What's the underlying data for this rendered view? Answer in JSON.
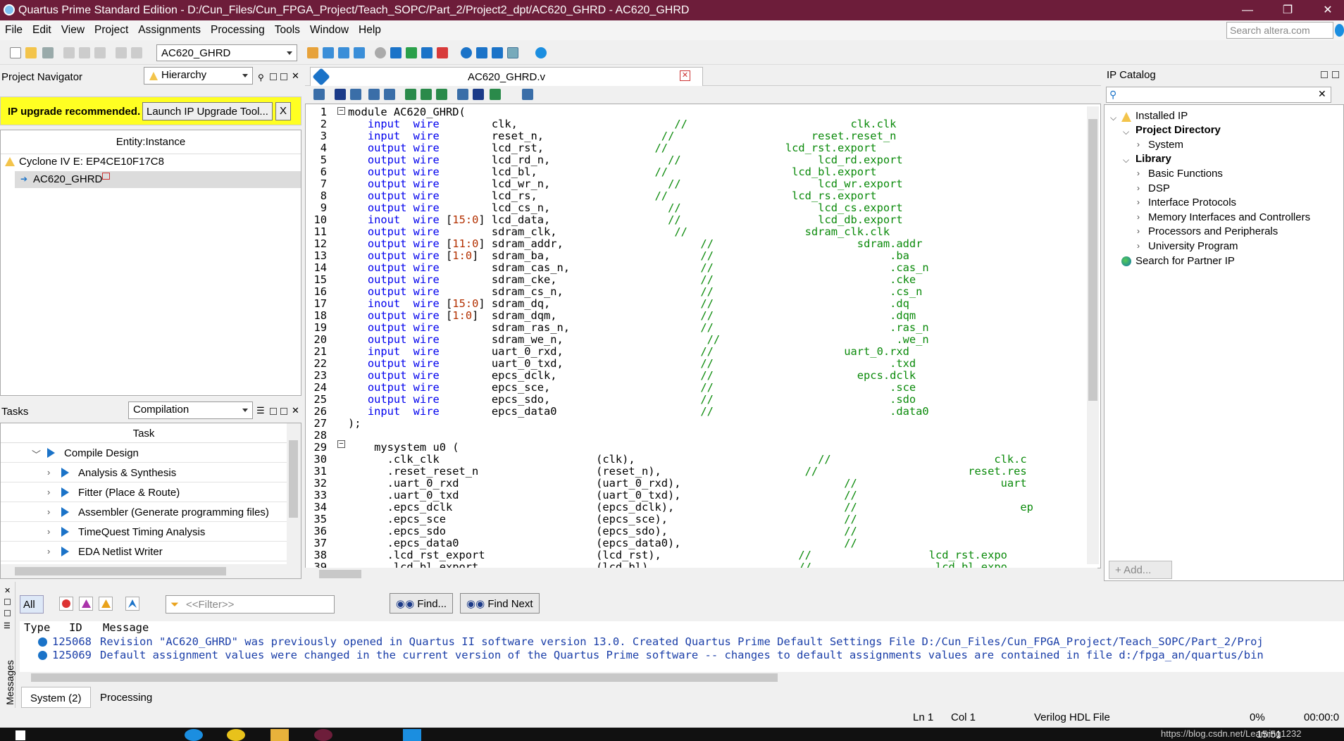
{
  "window": {
    "title": "Quartus Prime Standard Edition - D:/Cun_Files/Cun_FPGA_Project/Teach_SOPC/Part_2/Project2_dpt/AC620_GHRD - AC620_GHRD",
    "min": "—",
    "max": "❐",
    "close": "✕"
  },
  "menu": [
    "File",
    "Edit",
    "View",
    "Project",
    "Assignments",
    "Processing",
    "Tools",
    "Window",
    "Help"
  ],
  "search": {
    "placeholder": "Search altera.com"
  },
  "toolbar": {
    "revision": "AC620_GHRD"
  },
  "navigator": {
    "title": "Project Navigator",
    "view": "Hierarchy",
    "upgrade_msg": "IP upgrade recommended.",
    "upgrade_btn": "Launch IP Upgrade Tool...",
    "upgrade_close": "X",
    "col": "Entity:Instance",
    "device": "Cyclone IV E: EP4CE10F17C8",
    "top": "AC620_GHRD"
  },
  "tasks": {
    "title": "Tasks",
    "flow": "Compilation",
    "col": "Task",
    "items": [
      "Compile Design",
      "Analysis & Synthesis",
      "Fitter (Place & Route)",
      "Assembler (Generate programming files)",
      "TimeQuest Timing Analysis",
      "EDA Netlist Writer"
    ]
  },
  "editor": {
    "tab": "AC620_GHRD.v",
    "close": "✕"
  },
  "ip": {
    "title": "IP Catalog",
    "installed": "Installed IP",
    "project_dir": "Project Directory",
    "system": "System",
    "library": "Library",
    "lib_items": [
      "Basic Functions",
      "DSP",
      "Interface Protocols",
      "Memory Interfaces and Controllers",
      "Processors and Peripherals",
      "University Program"
    ],
    "partner": "Search for Partner IP",
    "add": "+ Add..."
  },
  "messages": {
    "all": "All",
    "filter": "<<Filter>>",
    "find": "Find...",
    "find_next": "Find Next",
    "h_type": "Type",
    "h_id": "ID",
    "h_msg": "Message",
    "rows": [
      {
        "id": "125068",
        "text": "Revision \"AC620_GHRD\" was previously opened in Quartus II software version 13.0. Created Quartus Prime Default Settings File D:/Cun_Files/Cun_FPGA_Project/Teach_SOPC/Part_2/Proj"
      },
      {
        "id": "125069",
        "text": "Default assignment values were changed in the current version of the Quartus Prime software -- changes to default assignments values are contained in file d:/fpga_an/quartus/bin"
      }
    ],
    "tab_system": "System (2)",
    "tab_processing": "Processing",
    "side_label": "Messages"
  },
  "status": {
    "ln": "Ln 1",
    "col": "Col 1",
    "type": "Verilog HDL File",
    "pct": "0%",
    "time": "00:00:0",
    "url": "https://blog.csdn.net/Learning1232",
    "clock": "15:51"
  }
}
